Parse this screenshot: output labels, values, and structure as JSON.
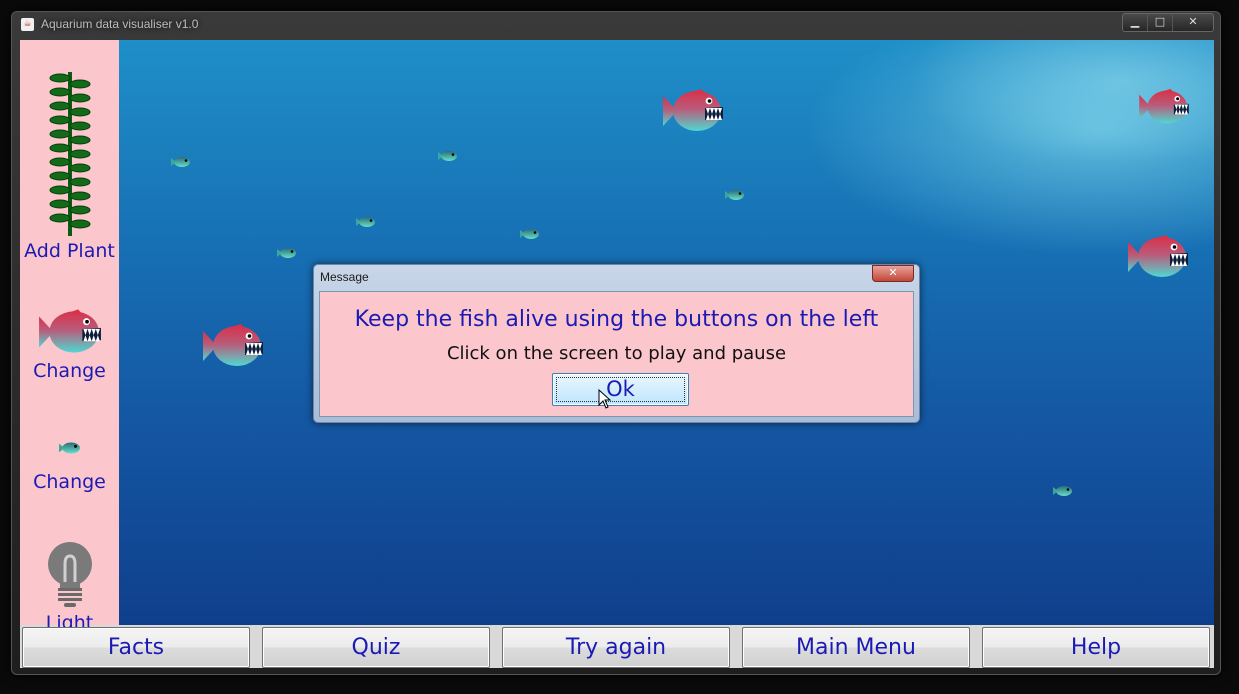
{
  "window": {
    "title": "Aquarium data visualiser v1.0",
    "controls": {
      "minimize": "▁",
      "maximize": "□",
      "close": "✕"
    }
  },
  "sidebar": {
    "items": [
      {
        "label": "Add Plant",
        "icon": "plant-icon"
      },
      {
        "label": "Change",
        "icon": "big-fish-icon"
      },
      {
        "label": "Change",
        "icon": "small-fish-icon"
      },
      {
        "label": "Light",
        "icon": "lightbulb-icon"
      }
    ]
  },
  "dialog": {
    "title": "Message",
    "close": "✕",
    "message": "Keep the fish alive using the buttons on the left",
    "sub_message": "Click on the screen to play and pause",
    "ok_label": "Ok"
  },
  "bottom_bar": {
    "buttons": [
      "Facts",
      "Quiz",
      "Try again",
      "Main Menu",
      "Help"
    ]
  },
  "colors": {
    "sidebar_bg": "#fbc6cc",
    "label_blue": "#1b1bb4",
    "water_top": "#1f8fc8",
    "water_bottom": "#0f3f8c",
    "fish_red": "#d03a52",
    "fish_teal": "#4fd3cf"
  }
}
